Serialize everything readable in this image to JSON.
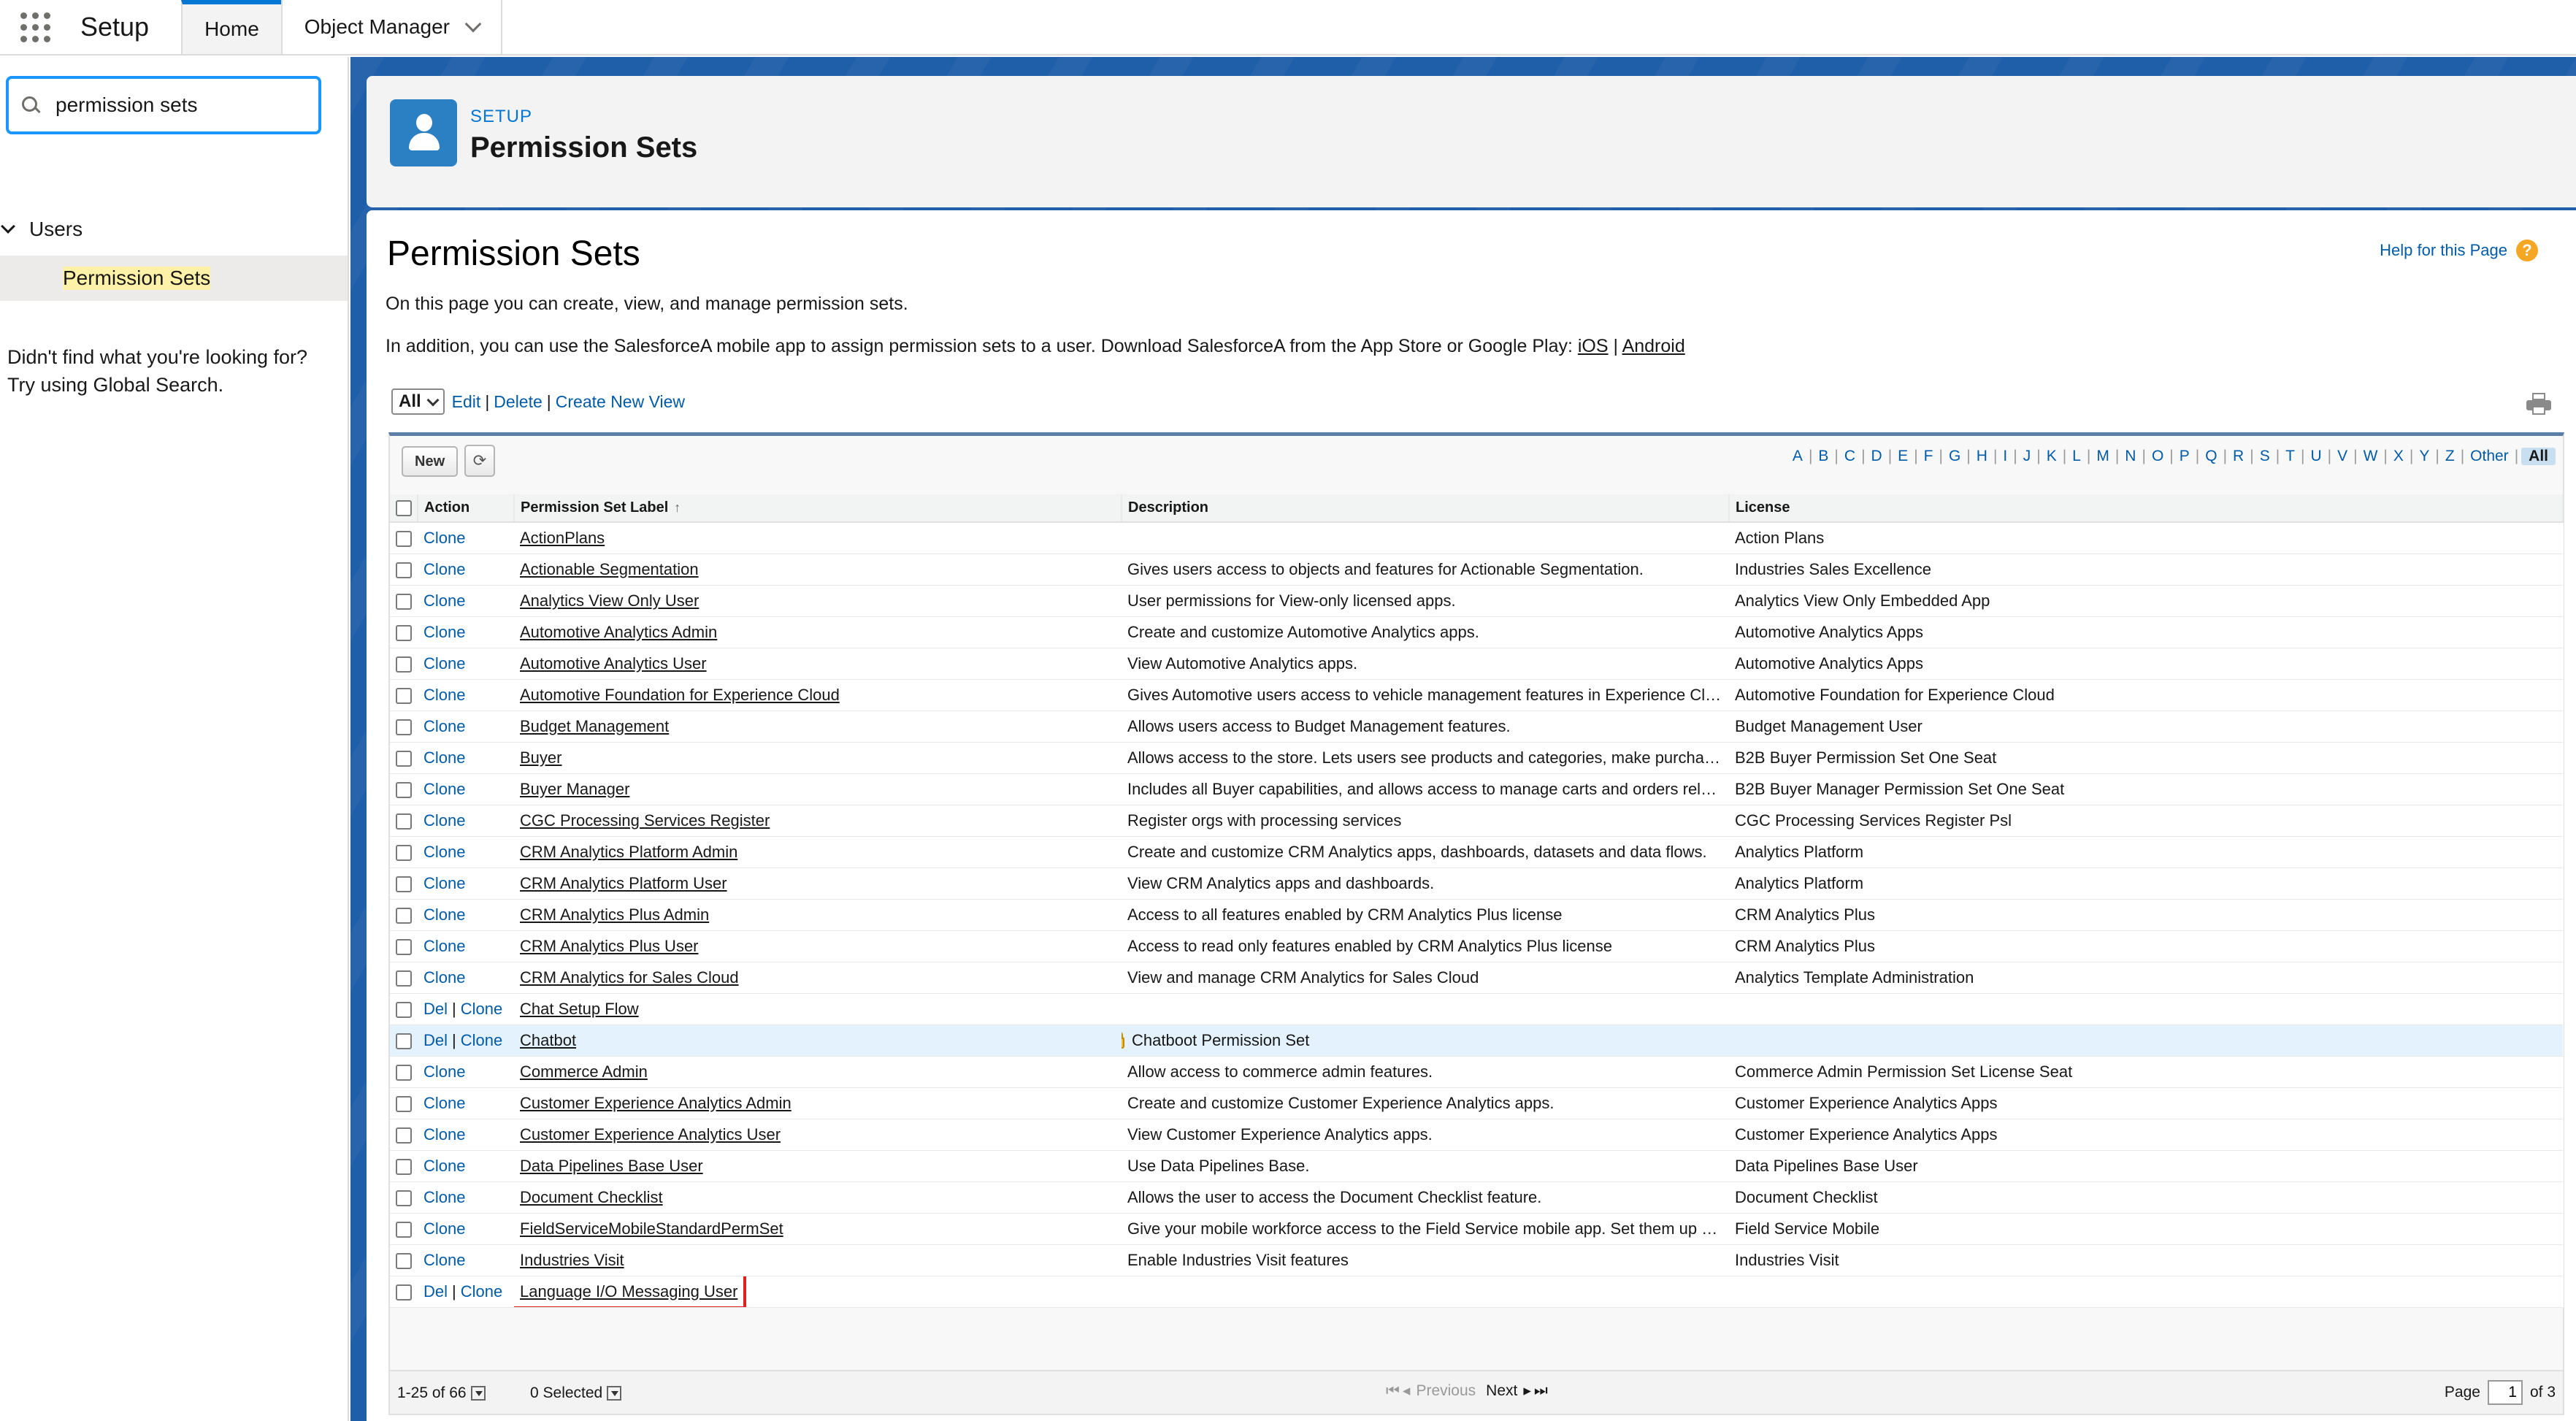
{
  "topbar": {
    "app_name": "Setup",
    "tabs": [
      {
        "label": "Home",
        "active": true
      },
      {
        "label": "Object Manager",
        "active": false
      }
    ]
  },
  "sidebar": {
    "search_value": "permission sets",
    "tree_parent": "Users",
    "tree_child": "Permission Sets",
    "not_found_line1": "Didn't find what you're looking for?",
    "not_found_line2": "Try using Global Search."
  },
  "header": {
    "eyebrow": "SETUP",
    "title": "Permission Sets"
  },
  "content": {
    "title": "Permission Sets",
    "help_label": "Help for this Page",
    "intro1": "On this page you can create, view, and manage permission sets.",
    "intro2_text": "In addition, you can use the SalesforceA mobile app to assign permission sets to a user. Download SalesforceA from the App Store or Google Play: ",
    "intro2_ios": "iOS",
    "intro2_sep": " | ",
    "intro2_android": "Android"
  },
  "view_bar": {
    "selected_view": "All",
    "edit": "Edit",
    "delete": "Delete",
    "create": "Create New View",
    "sep": "|"
  },
  "toolbar": {
    "new_label": "New",
    "refresh_glyph": "⟳",
    "alphabet": [
      "A",
      "B",
      "C",
      "D",
      "E",
      "F",
      "G",
      "H",
      "I",
      "J",
      "K",
      "L",
      "M",
      "N",
      "O",
      "P",
      "Q",
      "R",
      "S",
      "T",
      "U",
      "V",
      "W",
      "X",
      "Y",
      "Z",
      "Other",
      "All"
    ]
  },
  "table": {
    "headers": {
      "action": "Action",
      "label": "Permission Set Label",
      "sort_glyph": "↑",
      "description": "Description",
      "license": "License"
    },
    "rows": [
      {
        "del": false,
        "clone": "Clone",
        "label": "ActionPlans",
        "description": "",
        "license": "Action Plans"
      },
      {
        "del": false,
        "clone": "Clone",
        "label": "Actionable Segmentation",
        "description": "Gives users access to objects and features for Actionable Segmentation.",
        "license": "Industries Sales Excellence"
      },
      {
        "del": false,
        "clone": "Clone",
        "label": "Analytics View Only User",
        "description": "User permissions for View-only licensed apps.",
        "license": "Analytics View Only Embedded App"
      },
      {
        "del": false,
        "clone": "Clone",
        "label": "Automotive Analytics Admin",
        "description": "Create and customize Automotive Analytics apps.",
        "license": "Automotive Analytics Apps"
      },
      {
        "del": false,
        "clone": "Clone",
        "label": "Automotive Analytics User",
        "description": "View Automotive Analytics apps.",
        "license": "Automotive Analytics Apps"
      },
      {
        "del": false,
        "clone": "Clone",
        "label": "Automotive Foundation for Experience Cloud",
        "description": "Gives Automotive users access to vehicle management features in Experience Cloud.",
        "license": "Automotive Foundation for Experience Cloud"
      },
      {
        "del": false,
        "clone": "Clone",
        "label": "Budget Management",
        "description": "Allows users access to Budget Management features.",
        "license": "Budget Management User"
      },
      {
        "del": false,
        "clone": "Clone",
        "label": "Buyer",
        "description": "Allows access to the store. Lets users see products and categories, make purchases, and view order history.",
        "license": "B2B Buyer Permission Set One Seat"
      },
      {
        "del": false,
        "clone": "Clone",
        "label": "Buyer Manager",
        "description": "Includes all Buyer capabilities, and allows access to manage carts and orders related to the buyer account.",
        "license": "B2B Buyer Manager Permission Set One Seat"
      },
      {
        "del": false,
        "clone": "Clone",
        "label": "CGC Processing Services Register",
        "description": "Register orgs with processing services",
        "license": "CGC Processing Services Register Psl"
      },
      {
        "del": false,
        "clone": "Clone",
        "label": "CRM Analytics Platform Admin",
        "description": "Create and customize CRM Analytics apps, dashboards, datasets and data flows.",
        "license": "Analytics Platform"
      },
      {
        "del": false,
        "clone": "Clone",
        "label": "CRM Analytics Platform User",
        "description": "View CRM Analytics apps and dashboards.",
        "license": "Analytics Platform"
      },
      {
        "del": false,
        "clone": "Clone",
        "label": "CRM Analytics Plus Admin",
        "description": "Access to all features enabled by CRM Analytics Plus license",
        "license": "CRM Analytics Plus"
      },
      {
        "del": false,
        "clone": "Clone",
        "label": "CRM Analytics Plus User",
        "description": "Access to read only features enabled by CRM Analytics Plus license",
        "license": "CRM Analytics Plus"
      },
      {
        "del": false,
        "clone": "Clone",
        "label": "CRM Analytics for Sales Cloud",
        "description": "View and manage CRM Analytics for Sales Cloud",
        "license": "Analytics Template Administration"
      },
      {
        "del": true,
        "clone": "Clone",
        "label": "Chat Setup Flow",
        "description": "",
        "license": ""
      },
      {
        "del": true,
        "clone": "Clone",
        "label": "Chatbot",
        "description": "Chatboot Permission Set",
        "license": "",
        "locked": true,
        "highlight": true
      },
      {
        "del": false,
        "clone": "Clone",
        "label": "Commerce Admin",
        "description": "Allow access to commerce admin features.",
        "license": "Commerce Admin Permission Set License Seat"
      },
      {
        "del": false,
        "clone": "Clone",
        "label": "Customer Experience Analytics Admin",
        "description": "Create and customize Customer Experience Analytics apps.",
        "license": "Customer Experience Analytics Apps"
      },
      {
        "del": false,
        "clone": "Clone",
        "label": "Customer Experience Analytics User",
        "description": "View Customer Experience Analytics apps.",
        "license": "Customer Experience Analytics Apps"
      },
      {
        "del": false,
        "clone": "Clone",
        "label": "Data Pipelines Base User",
        "description": "Use Data Pipelines Base.",
        "license": "Data Pipelines Base User"
      },
      {
        "del": false,
        "clone": "Clone",
        "label": "Document Checklist",
        "description": "Allows the user to access the Document Checklist feature.",
        "license": "Document Checklist"
      },
      {
        "del": false,
        "clone": "Clone",
        "label": "FieldServiceMobileStandardPermSet",
        "description": "Give your mobile workforce access to the Field Service mobile app. Set them up with the Field Service Mobile license.",
        "license": "Field Service Mobile"
      },
      {
        "del": false,
        "clone": "Clone",
        "label": "Industries Visit",
        "description": "Enable Industries Visit features",
        "license": "Industries Visit"
      },
      {
        "del": true,
        "clone": "Clone",
        "label": "Language I/O Messaging User",
        "description": "",
        "license": "",
        "boxed": true
      }
    ]
  },
  "footer": {
    "range": "1-25 of 66",
    "selected": "0 Selected",
    "first_glyph": "⏮",
    "prev_glyph": "◂",
    "prev": "Previous",
    "next": "Next",
    "next_glyph": "▸",
    "last_glyph": "⏭",
    "page_label": "Page",
    "page_value": "1",
    "page_of": "of 3"
  }
}
